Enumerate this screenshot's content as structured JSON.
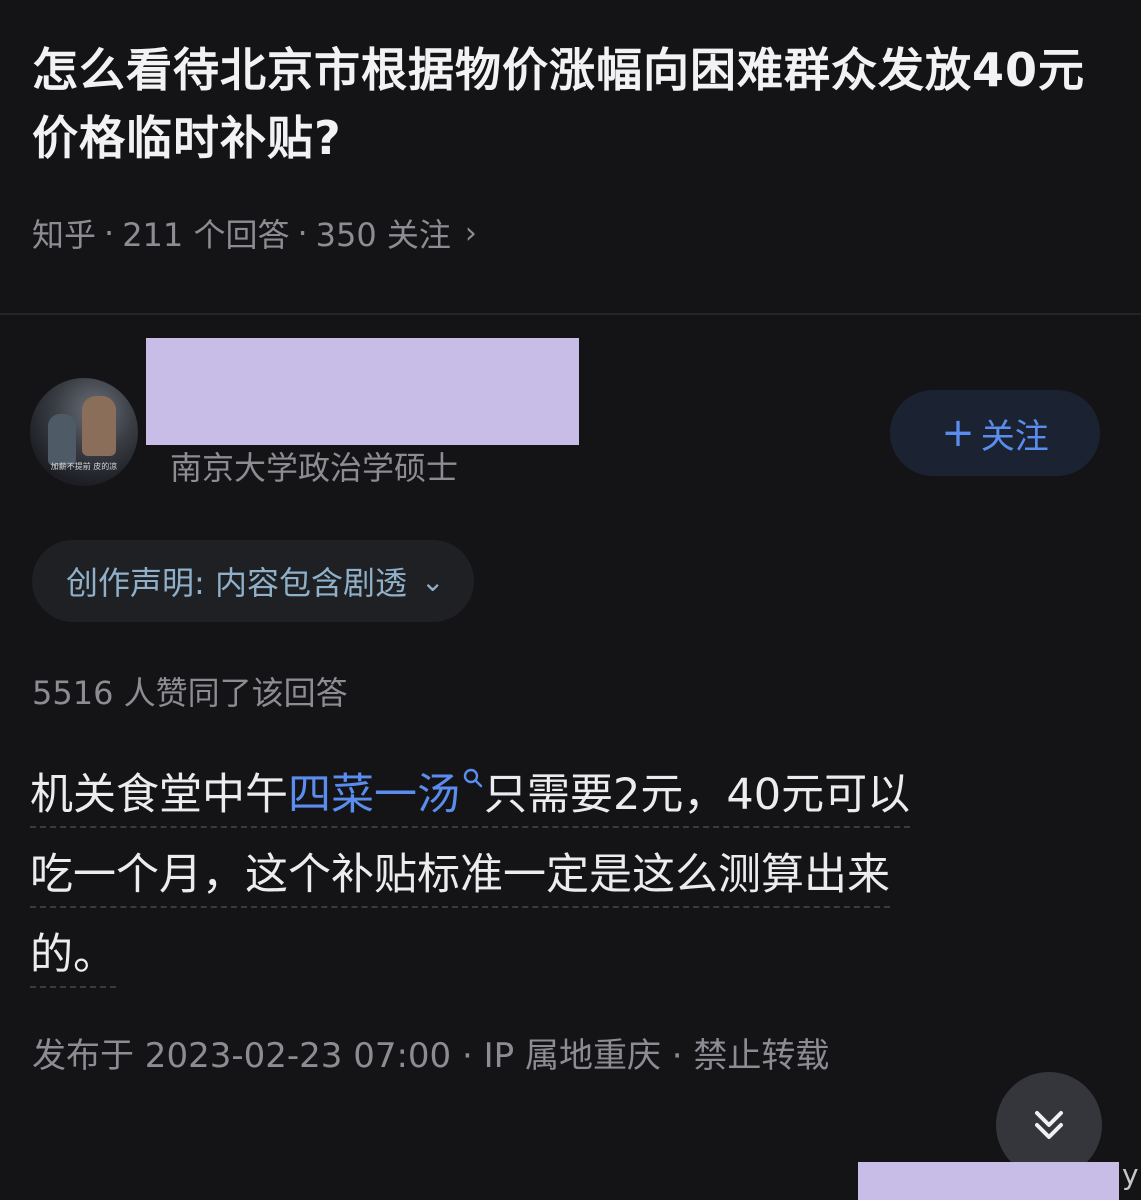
{
  "question": {
    "title": "怎么看待北京市根据物价涨幅向困难群众发放40元价格临时补贴?",
    "source": "知乎",
    "separator": "·",
    "answers": "211 个回答",
    "followers": "350 关注",
    "chevron": "›"
  },
  "author": {
    "avatar_caption": "加薪不提前 皮的凉",
    "bio": "南京大学政治学硕士",
    "follow_plus": "+",
    "follow_label": "关注"
  },
  "declaration": {
    "label": "创作声明: 内容包含剧透",
    "chevron": "⌄"
  },
  "answer": {
    "upvotes": "5516 人赞同了该回答",
    "line1_before": "机关食堂中午",
    "line1_keyword": "四菜一汤",
    "line1_after": "只需要2元，40元可以",
    "line2": "吃一个月，这个补贴标准一定是这么测算出来",
    "line3": "的。",
    "publish_info": "发布于 2023-02-23 07:00 · IP 属地重庆 · 禁止转载"
  },
  "corner_text": "y",
  "icons": {
    "search": "search-icon",
    "scroll_down": "double-chevron-down-icon"
  },
  "colors": {
    "background": "#141416",
    "accent": "#5b8def",
    "muted_text": "#8c8c92",
    "redaction": "#c8bde6"
  }
}
